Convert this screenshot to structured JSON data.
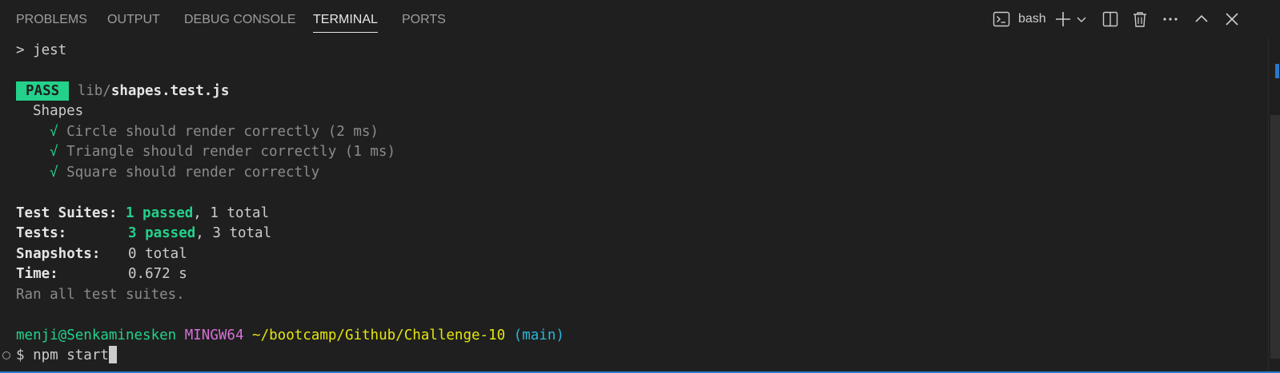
{
  "tabs": [
    {
      "label": "PROBLEMS",
      "active": false
    },
    {
      "label": "OUTPUT",
      "active": false
    },
    {
      "label": "DEBUG CONSOLE",
      "active": false
    },
    {
      "label": "TERMINAL",
      "active": true
    },
    {
      "label": "PORTS",
      "active": false
    }
  ],
  "toolbar": {
    "shell_label": "bash",
    "icons": [
      "terminal-icon",
      "plus-icon",
      "chevron-down-icon",
      "split-icon",
      "trash-icon",
      "more-icon",
      "chevron-up-icon",
      "close-icon"
    ]
  },
  "terminal": {
    "command_line": "> jest",
    "pass_badge": "PASS",
    "test_file_dir": "lib/",
    "test_file_name": "shapes.test.js",
    "suite_name": "Shapes",
    "check_mark": "√",
    "tests": [
      "Circle should render correctly (2 ms)",
      "Triangle should render correctly (1 ms)",
      "Square should render correctly"
    ],
    "summary": {
      "suites_label": "Test Suites:",
      "suites_passed": "1 passed",
      "suites_total": ", 1 total",
      "tests_label": "Tests:",
      "tests_passed": "3 passed",
      "tests_total": ", 3 total",
      "snapshots_label": "Snapshots:",
      "snapshots_value": "0 total",
      "time_label": "Time:",
      "time_value": "0.672 s",
      "ran_all": "Ran all test suites."
    },
    "prompt": {
      "user_host": "menji@Senkaminesken",
      "system": "MINGW64",
      "path": "~/bootcamp/Github/Challenge-10",
      "branch": "(main)",
      "dollar": "$",
      "input": "npm start"
    }
  },
  "colors": {
    "background": "#1f1f1f",
    "green": "#23d18b",
    "magenta": "#d670d6",
    "yellow": "#e5e510",
    "cyan": "#29b8db",
    "accent_border": "#2b79c9"
  }
}
